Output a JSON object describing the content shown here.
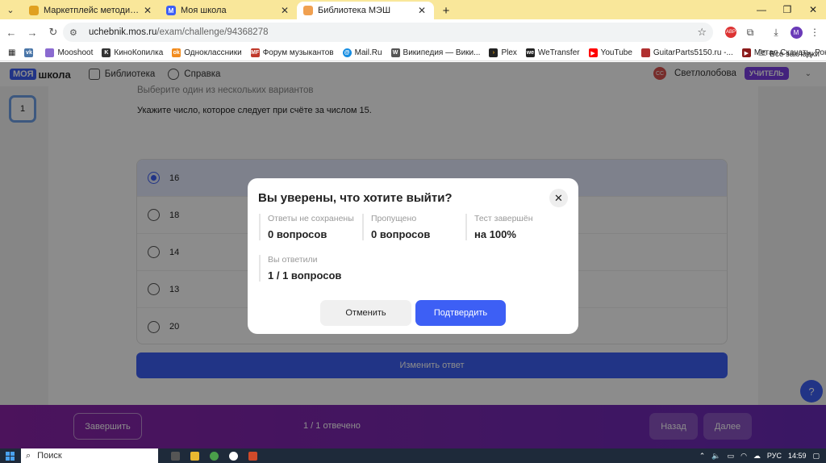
{
  "browser": {
    "tabs": [
      {
        "title": "Маркетплейс методических р",
        "favicon_color": "#e0a020",
        "active": false
      },
      {
        "title": "Моя школа",
        "favicon_color": "#3d5ff5",
        "active": false
      },
      {
        "title": "Библиотека МЭШ",
        "favicon_color": "#f0a050",
        "active": true
      }
    ],
    "url_host": "uchebnik.mos.ru",
    "url_path": "/exam/challenge/94368278",
    "profile_initial": "M",
    "bookmarks": [
      {
        "label": "",
        "color": "#4a76a8",
        "icon": "vk-icon"
      },
      {
        "label": "Mooshoot",
        "color": "#8a6ad0",
        "icon": "mooshoot-icon"
      },
      {
        "label": "КиноКопилка",
        "color": "#333333",
        "icon": "kinokopilka-icon"
      },
      {
        "label": "Одноклассники",
        "color": "#f28c1e",
        "icon": "ok-icon"
      },
      {
        "label": "Форум музыкантов",
        "color": "#c0392b",
        "icon": "mf-icon"
      },
      {
        "label": "Mail.Ru",
        "color": "#168de2",
        "icon": "mailru-icon"
      },
      {
        "label": "Википедия — Вики...",
        "color": "#555555",
        "icon": "wikipedia-icon"
      },
      {
        "label": "Plex",
        "color": "#e5a00d",
        "icon": "plex-icon"
      },
      {
        "label": "WeTransfer",
        "color": "#222222",
        "icon": "wetransfer-icon"
      },
      {
        "label": "YouTube",
        "color": "#ff0000",
        "icon": "youtube-icon"
      },
      {
        "label": "GuitarParts5150.ru -...",
        "color": "#b03030",
        "icon": "guitarparts-icon"
      },
      {
        "label": "Метал Скачать, Рок...",
        "color": "#8b1a1a",
        "icon": "metal-icon"
      }
    ],
    "bookmarks_more": "»",
    "all_bookmarks": "Все закладки"
  },
  "site": {
    "logo_part1": "МОЯ",
    "logo_part2": "школа",
    "menu": [
      "Библиотека",
      "Справка"
    ],
    "user_initials": "СС",
    "user_name": "Светлолобова",
    "user_role": "УЧИТЕЛЬ"
  },
  "question": {
    "number": "1",
    "hint": "Выберите один из нескольких вариантов",
    "text": "Укажите число, которое следует при счёте за числом 15.",
    "options": [
      "16",
      "18",
      "14",
      "13",
      "20"
    ],
    "selected_index": 0,
    "change_answer": "Изменить ответ"
  },
  "footer": {
    "finish": "Завершить",
    "progress": "1 / 1 отвечено",
    "prev": "Назад",
    "next": "Далее"
  },
  "help_label": "?",
  "modal": {
    "title": "Вы уверены, что хотите выйти?",
    "stats": [
      {
        "label": "Ответы не сохранены",
        "value": "0 вопросов"
      },
      {
        "label": "Пропущено",
        "value": "0 вопросов"
      },
      {
        "label": "Тест завершён",
        "value": "на 100%"
      },
      {
        "label": "Вы ответили",
        "value": "1 / 1 вопросов"
      }
    ],
    "cancel": "Отменить",
    "confirm": "Подтвердить"
  },
  "taskbar": {
    "search_placeholder": "Поиск",
    "lang": "РУС",
    "time": "14:59"
  }
}
